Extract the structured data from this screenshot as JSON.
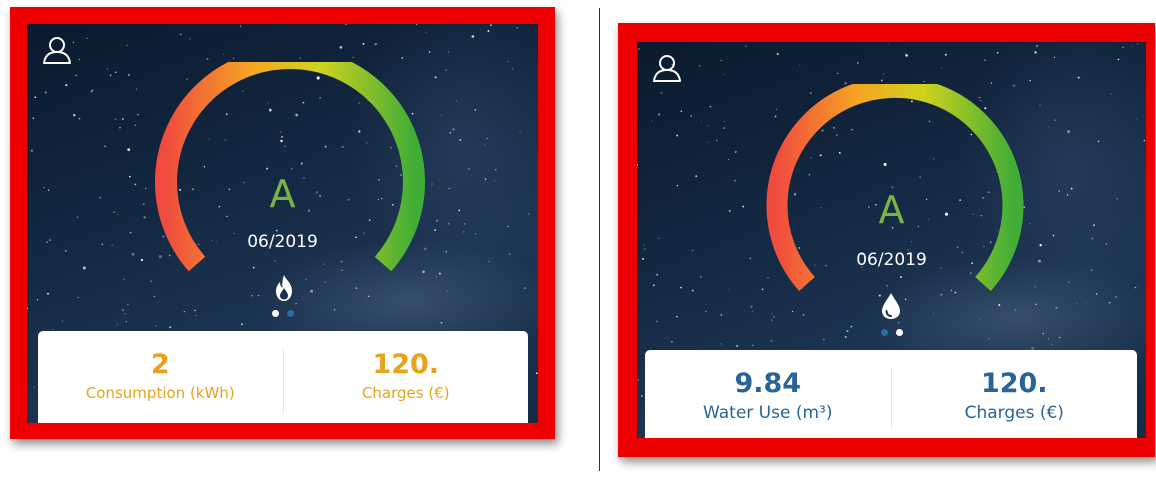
{
  "colors": {
    "frame": "#ee0000",
    "grade": "#7cb342",
    "gas_accent": "#e8a21c",
    "water_accent": "#2a6496",
    "gauge_gradient": [
      "#f0503c",
      "#f5a623",
      "#d4d41c",
      "#45b035"
    ]
  },
  "panels": [
    {
      "utility": "gas",
      "profile_icon": "user-icon",
      "utility_icon": "flame-icon",
      "grade": "A",
      "date": "06/2019",
      "active_page": 1,
      "page_count": 2,
      "metrics": [
        {
          "value": "2",
          "label": "Consumption (kWh)"
        },
        {
          "value": "120.",
          "label": "Charges (€)"
        }
      ]
    },
    {
      "utility": "water",
      "profile_icon": "user-icon",
      "utility_icon": "water-drop-icon",
      "grade": "A",
      "date": "06/2019",
      "active_page": 2,
      "page_count": 2,
      "metrics": [
        {
          "value": "9.84",
          "label": "Water Use (m³)"
        },
        {
          "value": "120.",
          "label": "Charges (€)"
        }
      ]
    }
  ]
}
